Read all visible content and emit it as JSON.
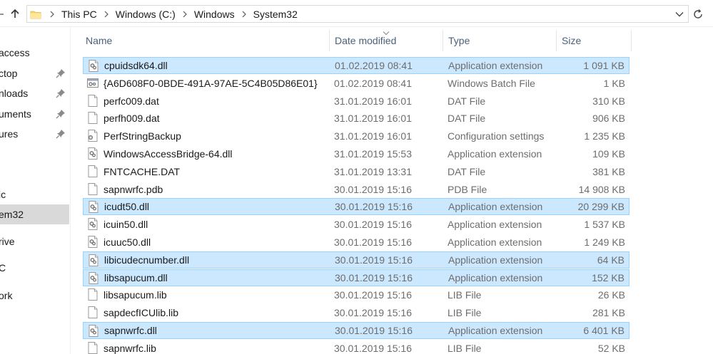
{
  "address": {
    "crumbs": [
      "This PC",
      "Windows (C:)",
      "Windows",
      "System32"
    ]
  },
  "sidebar": {
    "items": [
      {
        "label": "access",
        "pinned": false,
        "selected": false
      },
      {
        "label": "ctop",
        "pinned": true,
        "selected": false
      },
      {
        "label": "nloads",
        "pinned": true,
        "selected": false
      },
      {
        "label": "uments",
        "pinned": true,
        "selected": false
      },
      {
        "label": "ures",
        "pinned": true,
        "selected": false
      },
      {
        "label": "ic",
        "pinned": false,
        "selected": false
      },
      {
        "label": "em32",
        "pinned": false,
        "selected": true
      },
      {
        "label": "rive",
        "pinned": false,
        "selected": false
      },
      {
        "label": "C",
        "pinned": false,
        "selected": false
      },
      {
        "label": "ork",
        "pinned": false,
        "selected": false
      }
    ]
  },
  "columns": {
    "name": "Name",
    "date": "Date modified",
    "type": "Type",
    "size": "Size"
  },
  "files": [
    {
      "name": "cpuidsdk64.dll",
      "date": "01.02.2019 08:41",
      "type": "Application extension",
      "size": "1 091 KB",
      "icon": "dll-icon",
      "selected": true
    },
    {
      "name": "{A6D608F0-0BDE-491A-97AE-5C4B05D86E01}",
      "date": "01.02.2019 08:41",
      "type": "Windows Batch File",
      "size": "1 KB",
      "icon": "batch-file-icon",
      "selected": false
    },
    {
      "name": "perfc009.dat",
      "date": "31.01.2019 16:01",
      "type": "DAT File",
      "size": "310 KB",
      "icon": "blank-file-icon",
      "selected": false
    },
    {
      "name": "perfh009.dat",
      "date": "31.01.2019 16:01",
      "type": "DAT File",
      "size": "906 KB",
      "icon": "blank-file-icon",
      "selected": false
    },
    {
      "name": "PerfStringBackup",
      "date": "31.01.2019 16:01",
      "type": "Configuration settings",
      "size": "1 235 KB",
      "icon": "config-file-icon",
      "selected": false
    },
    {
      "name": "WindowsAccessBridge-64.dll",
      "date": "31.01.2019 15:53",
      "type": "Application extension",
      "size": "109 KB",
      "icon": "dll-icon",
      "selected": false
    },
    {
      "name": "FNTCACHE.DAT",
      "date": "31.01.2019 13:31",
      "type": "DAT File",
      "size": "381 KB",
      "icon": "blank-file-icon",
      "selected": false
    },
    {
      "name": "sapnwrfc.pdb",
      "date": "30.01.2019 15:16",
      "type": "PDB File",
      "size": "14 908 KB",
      "icon": "blank-file-icon",
      "selected": false
    },
    {
      "name": "icudt50.dll",
      "date": "30.01.2019 15:16",
      "type": "Application extension",
      "size": "20 299 KB",
      "icon": "dll-icon",
      "selected": true
    },
    {
      "name": "icuin50.dll",
      "date": "30.01.2019 15:16",
      "type": "Application extension",
      "size": "1 537 KB",
      "icon": "dll-icon",
      "selected": false
    },
    {
      "name": "icuuc50.dll",
      "date": "30.01.2019 15:16",
      "type": "Application extension",
      "size": "1 249 KB",
      "icon": "dll-icon",
      "selected": false
    },
    {
      "name": "libicudecnumber.dll",
      "date": "30.01.2019 15:16",
      "type": "Application extension",
      "size": "64 KB",
      "icon": "dll-icon",
      "selected": true
    },
    {
      "name": "libsapucum.dll",
      "date": "30.01.2019 15:16",
      "type": "Application extension",
      "size": "152 KB",
      "icon": "dll-icon",
      "selected": true
    },
    {
      "name": "libsapucum.lib",
      "date": "30.01.2019 15:16",
      "type": "LIB File",
      "size": "26 KB",
      "icon": "blank-file-icon",
      "selected": false
    },
    {
      "name": "sapdecfICUlib.lib",
      "date": "30.01.2019 15:16",
      "type": "LIB File",
      "size": "281 KB",
      "icon": "blank-file-icon",
      "selected": false
    },
    {
      "name": "sapnwrfc.dll",
      "date": "30.01.2019 15:16",
      "type": "Application extension",
      "size": "6 401 KB",
      "icon": "dll-icon",
      "selected": true
    },
    {
      "name": "sapnwrfc.lib",
      "date": "30.01.2019 15:16",
      "type": "LIB File",
      "size": "52 KB",
      "icon": "blank-file-icon",
      "selected": false
    }
  ],
  "colors": {
    "selection_bg": "#cce8ff",
    "selection_border": "#99d1ff",
    "header_text": "#4c607a",
    "folder_yellow": "#f8d775"
  }
}
